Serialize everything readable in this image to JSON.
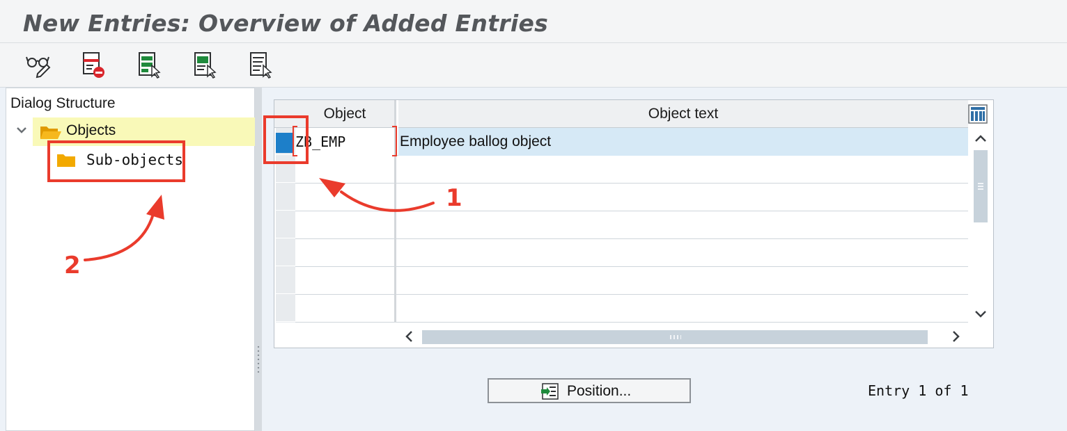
{
  "window": {
    "title": "New Entries: Overview of Added Entries"
  },
  "toolbar": {
    "buttons": [
      {
        "icon": "display-glasses-icon"
      },
      {
        "icon": "delete-entry-icon"
      },
      {
        "icon": "select-all-icon"
      },
      {
        "icon": "select-block-icon"
      },
      {
        "icon": "deselect-all-icon"
      }
    ]
  },
  "dialog_structure": {
    "title": "Dialog Structure",
    "items": [
      {
        "label": "Objects",
        "expanded": true,
        "selected": true,
        "icon": "folder-open-icon"
      },
      {
        "label": "Sub-objects",
        "expanded": false,
        "selected": false,
        "icon": "folder-icon"
      }
    ]
  },
  "table": {
    "columns": [
      "Object",
      "Object text"
    ],
    "rows": [
      {
        "object": "ZB_EMP",
        "text": "Employee ballog object"
      }
    ]
  },
  "footer": {
    "position_button": "Position...",
    "entry_status": "Entry 1 of 1"
  },
  "annotations": {
    "labels": [
      "1",
      "2"
    ],
    "color": "#ea3b2c"
  },
  "colors": {
    "selection_blue": "#1d7fc9",
    "selected_row": "#d6e9f6",
    "tree_highlight": "#f9f9b8",
    "folder": "#f2a900"
  }
}
